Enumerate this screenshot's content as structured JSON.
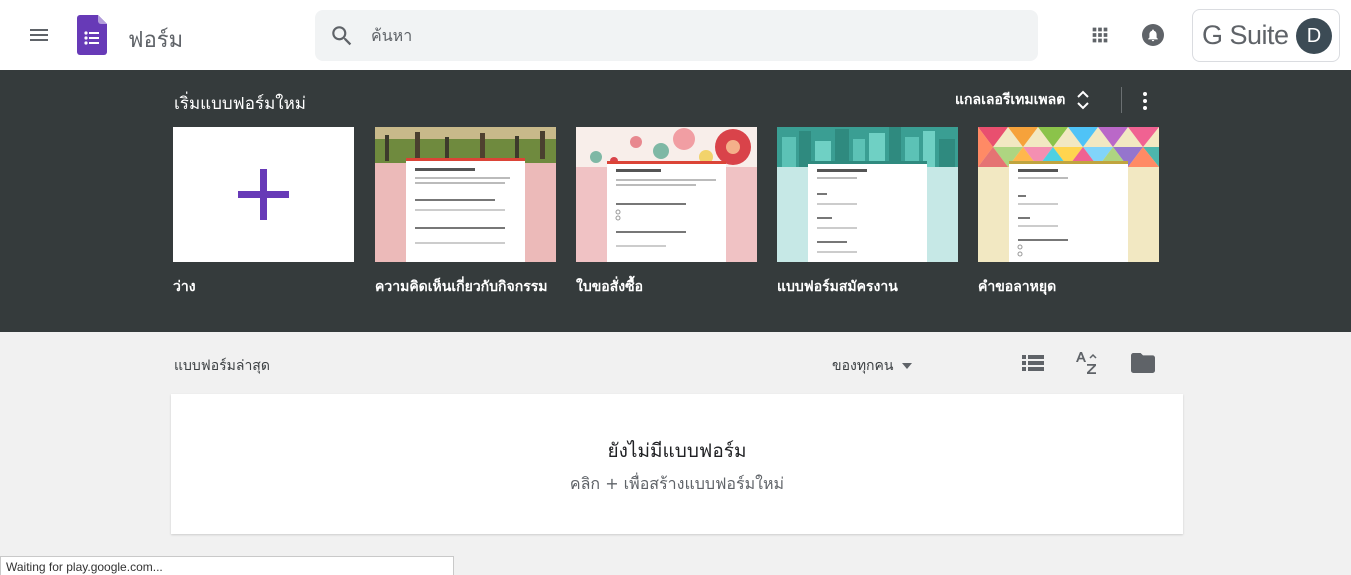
{
  "header": {
    "menu_icon": "hamburger-menu-icon",
    "app_icon": "forms-logo-icon",
    "app_title": "ฟอร์ม",
    "search_placeholder": "ค้นหา",
    "apps_icon": "apps-grid-icon",
    "notifications_icon": "notifications-bell-icon",
    "gsuite_label": "G Suite",
    "avatar_letter": "D"
  },
  "gallery": {
    "heading": "เริ่มแบบฟอร์มใหม่",
    "toggle_label": "แกลเลอรีเทมเพลต",
    "templates": [
      {
        "label": "ว่าง"
      },
      {
        "label": "ความคิดเห็นเกี่ยวกับกิจกรรม"
      },
      {
        "label": "ใบขอสั่งซื้อ"
      },
      {
        "label": "แบบฟอร์มสมัครงาน"
      },
      {
        "label": "คำขอลาหยุด"
      }
    ]
  },
  "recent": {
    "title": "แบบฟอร์มล่าสุด",
    "owner_filter": "ของทุกคน",
    "empty_title": "ยังไม่มีแบบฟอร์ม",
    "empty_subtitle": "คลิก + เพื่อสร้างแบบฟอร์มใหม่"
  },
  "statusbar": {
    "text": "Waiting for play.google.com..."
  },
  "colors": {
    "forms_purple": "#673ab7",
    "gallery_bg": "#353b3c",
    "page_bg": "#f1f1f1",
    "avatar_bg": "#3c4b55"
  }
}
